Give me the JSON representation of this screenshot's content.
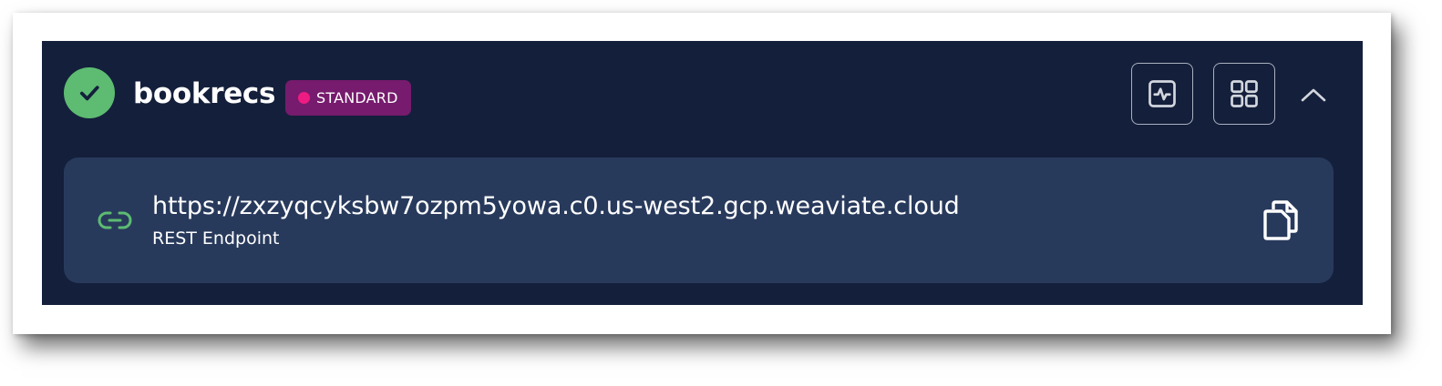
{
  "cluster": {
    "name": "bookrecs",
    "status_icon": "check-icon",
    "status_color": "#5dbb72"
  },
  "tier_badge": {
    "label": "STANDARD",
    "badge_color": "#761b6d",
    "dot_color": "#ee1c82"
  },
  "actions": {
    "metrics_icon": "activity-icon",
    "dashboard_icon": "grid-icon",
    "collapse_icon": "chevron-up-icon"
  },
  "endpoint": {
    "url": "https://zxzyqcyksbw7ozpm5yowa.c0.us-west2.gcp.weaviate.cloud",
    "label": "REST Endpoint",
    "link_icon": "link-icon",
    "copy_icon": "copy-icon"
  },
  "colors": {
    "card_background": "#141f3b",
    "panel_background": "#283a5c",
    "accent_green": "#5dbb72"
  }
}
